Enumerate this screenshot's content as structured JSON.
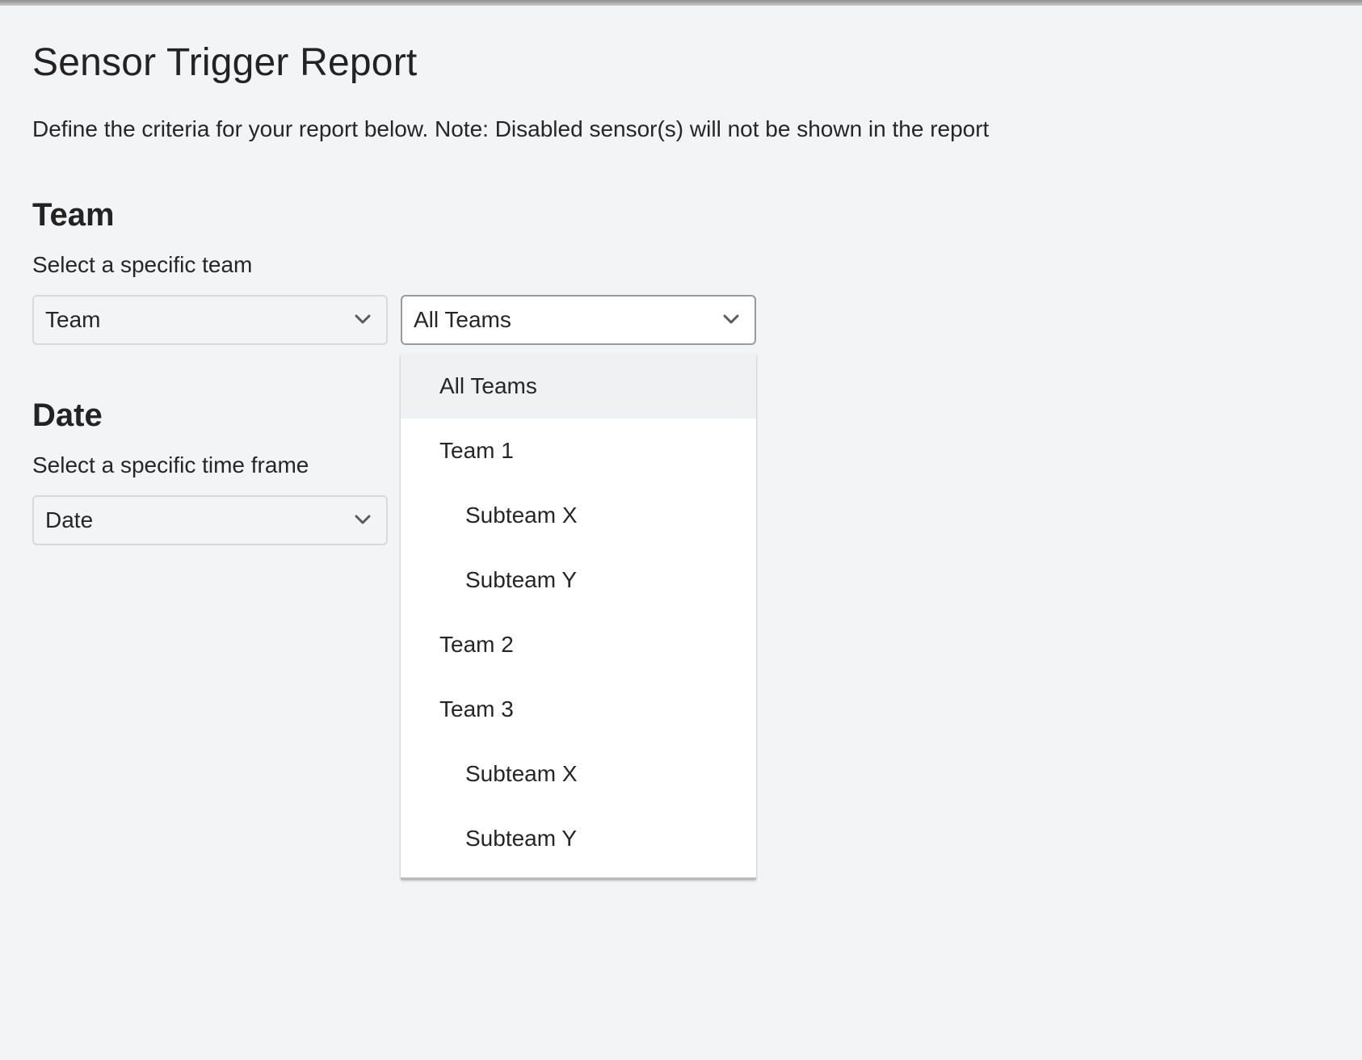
{
  "page": {
    "title": "Sensor Trigger Report",
    "intro": "Define the criteria for your report below. Note: Disabled sensor(s) will not be shown in the report"
  },
  "team_section": {
    "heading": "Team",
    "description": "Select a specific team",
    "type_select": {
      "value": "Team"
    },
    "team_select": {
      "value": "All Teams",
      "expanded": true
    },
    "options": [
      {
        "label": "All Teams",
        "level": 0,
        "selected": true
      },
      {
        "label": "Team 1",
        "level": 0,
        "selected": false
      },
      {
        "label": "Subteam X",
        "level": 1,
        "selected": false
      },
      {
        "label": "Subteam Y",
        "level": 1,
        "selected": false
      },
      {
        "label": "Team 2",
        "level": 0,
        "selected": false
      },
      {
        "label": "Team 3",
        "level": 0,
        "selected": false
      },
      {
        "label": "Subteam X",
        "level": 1,
        "selected": false
      },
      {
        "label": "Subteam Y",
        "level": 1,
        "selected": false
      }
    ]
  },
  "date_section": {
    "heading": "Date",
    "description": "Select a specific time frame",
    "date_select": {
      "value": "Date"
    }
  },
  "icons": {
    "chevron": "chevron-down-icon"
  },
  "colors": {
    "background": "#f3f4f6",
    "selected_option": "#f0f1f3",
    "text": "#222222"
  }
}
